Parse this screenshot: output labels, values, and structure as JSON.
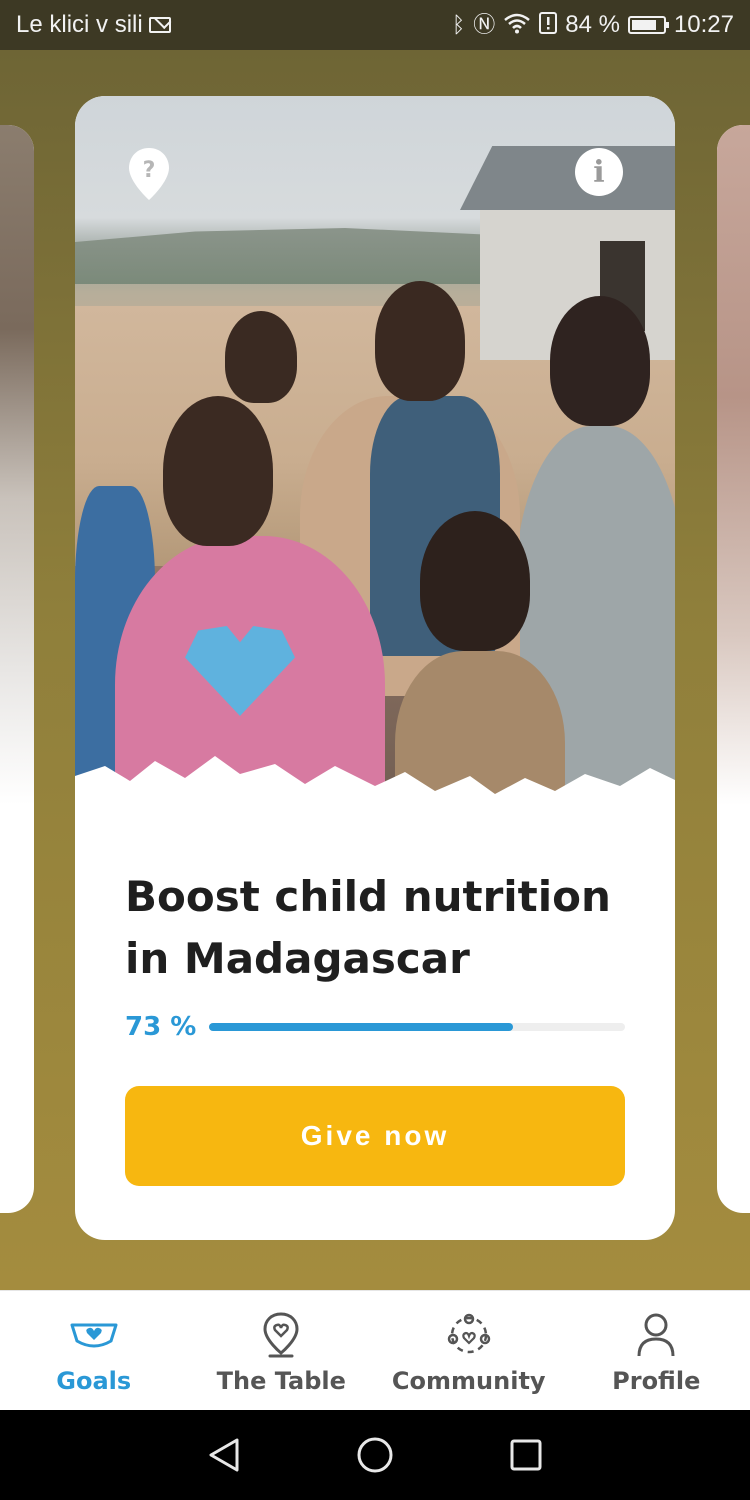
{
  "status_bar": {
    "carrier": "Le klici v sili",
    "battery": "84 %",
    "battery_level": 0.84,
    "time": "10:27",
    "icons": [
      "mail-icon",
      "bluetooth-icon",
      "nfc-icon",
      "wifi-icon",
      "alert-icon",
      "battery-icon"
    ]
  },
  "card": {
    "title_line1": "Boost child nutrition",
    "title_line2": "in Madagascar",
    "progress_label": "73 %",
    "progress": 0.73,
    "cta": "Give now",
    "icons": [
      "location-question-icon",
      "info-icon"
    ]
  },
  "nav": {
    "items": [
      {
        "label": "Goals",
        "icon": "bowl-icon",
        "active": true
      },
      {
        "label": "The Table",
        "icon": "map-pin-heart-icon",
        "active": false
      },
      {
        "label": "Community",
        "icon": "community-icon",
        "active": false
      },
      {
        "label": "Profile",
        "icon": "person-icon",
        "active": false
      }
    ]
  },
  "colors": {
    "accent": "#2a98d6",
    "cta": "#f7b710",
    "background_top": "#6e6535",
    "background_bottom": "#a48c3e"
  }
}
